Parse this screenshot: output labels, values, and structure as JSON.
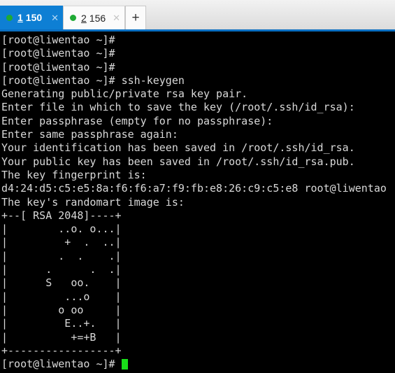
{
  "tabbar": {
    "tabs": [
      {
        "number": "1",
        "label": "150",
        "close": "✕",
        "status_icon": "status-dot-green",
        "active": true
      },
      {
        "number": "2",
        "label": "156",
        "close": "✕",
        "status_icon": "status-dot-green",
        "active": false
      }
    ],
    "new_tab_label": "+",
    "active_tab_color": "#0e7fd4",
    "status_dot_color": "#1faa34",
    "accent_underline_color": "#0a6fc2"
  },
  "terminal": {
    "foreground_color": "#d9d9d9",
    "background_color": "#000000",
    "cursor_color": "#19e019",
    "lines": [
      "[root@liwentao ~]#",
      "[root@liwentao ~]#",
      "[root@liwentao ~]#",
      "[root@liwentao ~]# ssh-keygen",
      "Generating public/private rsa key pair.",
      "Enter file in which to save the key (/root/.ssh/id_rsa):",
      "Enter passphrase (empty for no passphrase):",
      "Enter same passphrase again:",
      "Your identification has been saved in /root/.ssh/id_rsa.",
      "Your public key has been saved in /root/.ssh/id_rsa.pub.",
      "The key fingerprint is:",
      "d4:24:d5:c5:e5:8a:f6:f6:a7:f9:fb:e8:26:c9:c5:e8 root@liwentao",
      "The key's randomart image is:",
      "+--[ RSA 2048]----+",
      "|        ..o. o...|",
      "|         +  .  ..|",
      "|        .  .    .|",
      "|      .      .  .|",
      "|      S   oo.    |",
      "|         ...o    |",
      "|        o oo     |",
      "|         E..+.   |",
      "|          +=+B   |",
      "+-----------------+"
    ],
    "prompt": "[root@liwentao ~]# "
  }
}
